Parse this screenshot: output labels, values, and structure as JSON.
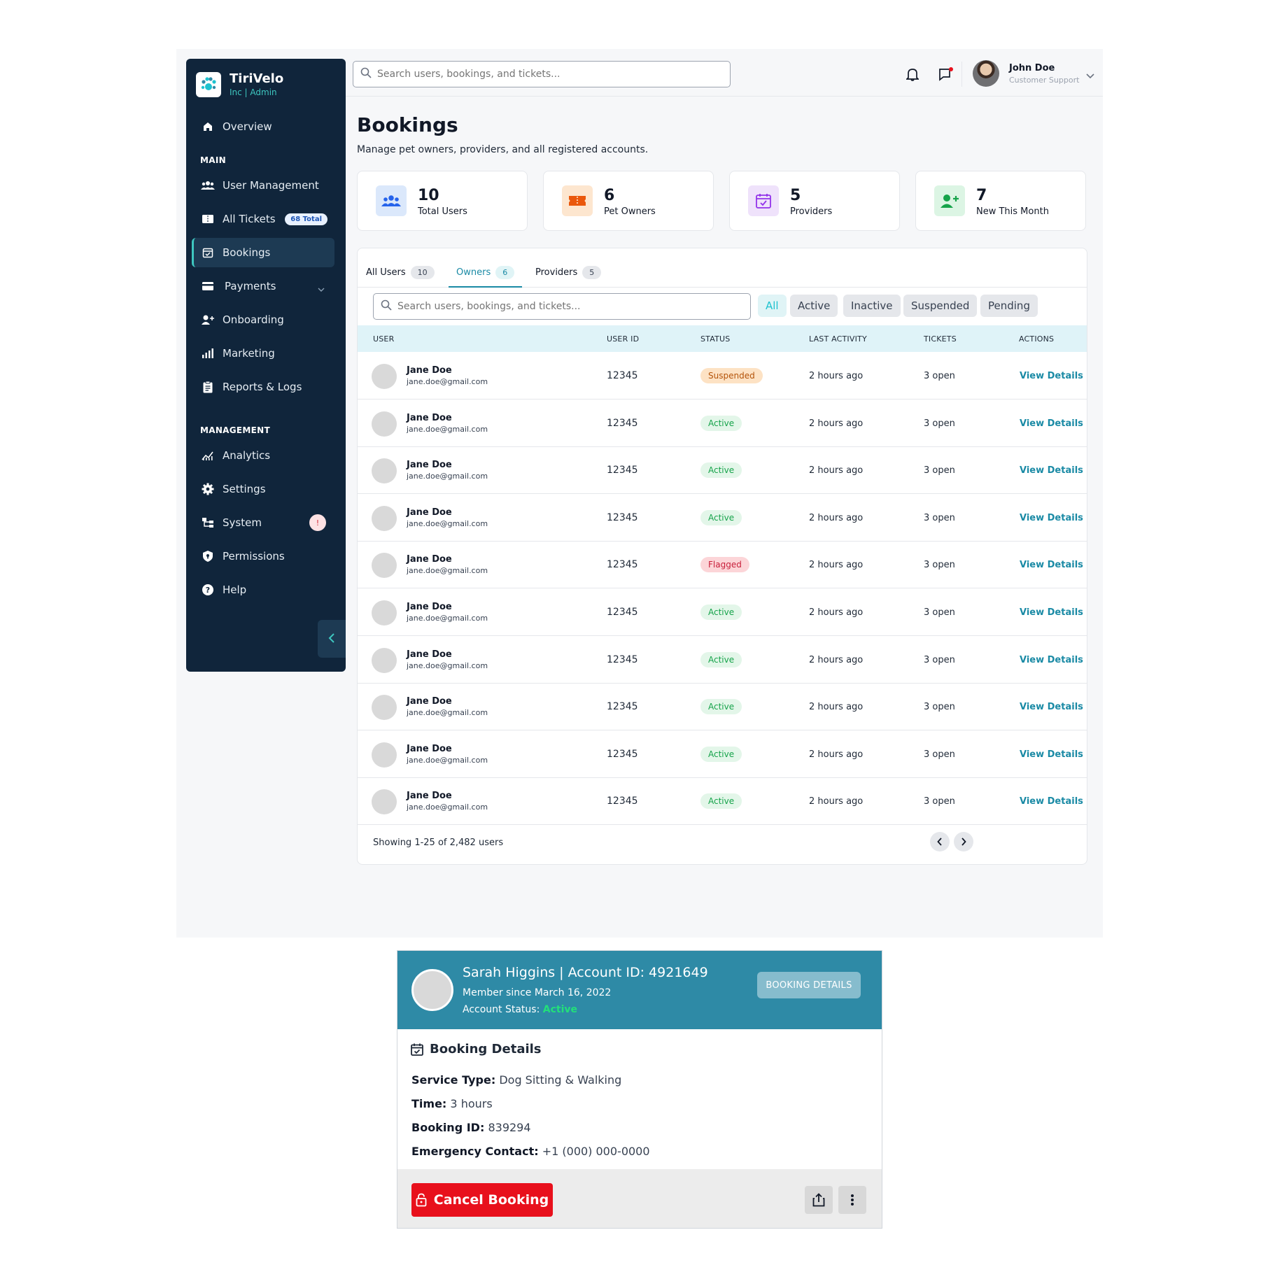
{
  "brand": {
    "name": "TiriVelo",
    "sub": "Inc | Admin"
  },
  "sidebar": {
    "overview": "Overview",
    "section_main": "MAIN",
    "section_management": "MANAGEMENT",
    "items": [
      {
        "label": "User Management",
        "icon": "users-icon"
      },
      {
        "label": "All Tickets",
        "icon": "ticket-icon",
        "badge": "68 Total"
      },
      {
        "label": "Bookings",
        "icon": "calendar-check-icon",
        "active": true
      },
      {
        "label": "Payments",
        "icon": "credit-card-icon"
      },
      {
        "label": "Onboarding",
        "icon": "user-plus-icon"
      },
      {
        "label": "Marketing",
        "icon": "bar-chart-icon"
      },
      {
        "label": "Reports & Logs",
        "icon": "clipboard-icon"
      }
    ],
    "management_items": [
      {
        "label": "Analytics",
        "icon": "line-chart-icon"
      },
      {
        "label": "Settings",
        "icon": "gear-icon"
      },
      {
        "label": "System",
        "icon": "network-icon",
        "badge": "!"
      },
      {
        "label": "Permissions",
        "icon": "shield-icon"
      },
      {
        "label": "Help",
        "icon": "help-circle-icon"
      }
    ]
  },
  "topbar": {
    "search_placeholder": "Search users, bookings, and tickets...",
    "user_name": "John Doe",
    "user_role": "Customer Support"
  },
  "page": {
    "title": "Bookings",
    "subtitle": "Manage pet owners, providers, and all registered accounts."
  },
  "stats": [
    {
      "value": "10",
      "label": "Total Users"
    },
    {
      "value": "6",
      "label": "Pet Owners"
    },
    {
      "value": "5",
      "label": "Providers"
    },
    {
      "value": "7",
      "label": "New This Month"
    }
  ],
  "tabs": [
    {
      "label": "All Users",
      "count": "10"
    },
    {
      "label": "Owners",
      "count": "6"
    },
    {
      "label": "Providers",
      "count": "5"
    }
  ],
  "filters": {
    "search_placeholder": "Search users, bookings, and tickets...",
    "chips": [
      "All",
      "Active",
      "Inactive",
      "Suspended",
      "Pending"
    ]
  },
  "table": {
    "headers": [
      "USER",
      "USER ID",
      "STATUS",
      "LAST ACTIVITY",
      "TICKETS",
      "ACTIONS"
    ],
    "rows": [
      {
        "name": "Jane Doe",
        "email": "jane.doe@gmail.com",
        "id": "12345",
        "status": "Suspended",
        "activity": "2 hours ago",
        "tickets": "3 open",
        "action": "View Details"
      },
      {
        "name": "Jane Doe",
        "email": "jane.doe@gmail.com",
        "id": "12345",
        "status": "Active",
        "activity": "2 hours ago",
        "tickets": "3 open",
        "action": "View Details"
      },
      {
        "name": "Jane Doe",
        "email": "jane.doe@gmail.com",
        "id": "12345",
        "status": "Active",
        "activity": "2 hours ago",
        "tickets": "3 open",
        "action": "View Details"
      },
      {
        "name": "Jane Doe",
        "email": "jane.doe@gmail.com",
        "id": "12345",
        "status": "Active",
        "activity": "2 hours ago",
        "tickets": "3 open",
        "action": "View Details"
      },
      {
        "name": "Jane Doe",
        "email": "jane.doe@gmail.com",
        "id": "12345",
        "status": "Flagged",
        "activity": "2 hours ago",
        "tickets": "3 open",
        "action": "View Details"
      },
      {
        "name": "Jane Doe",
        "email": "jane.doe@gmail.com",
        "id": "12345",
        "status": "Active",
        "activity": "2 hours ago",
        "tickets": "3 open",
        "action": "View Details"
      },
      {
        "name": "Jane Doe",
        "email": "jane.doe@gmail.com",
        "id": "12345",
        "status": "Active",
        "activity": "2 hours ago",
        "tickets": "3 open",
        "action": "View Details"
      },
      {
        "name": "Jane Doe",
        "email": "jane.doe@gmail.com",
        "id": "12345",
        "status": "Active",
        "activity": "2 hours ago",
        "tickets": "3 open",
        "action": "View Details"
      },
      {
        "name": "Jane Doe",
        "email": "jane.doe@gmail.com",
        "id": "12345",
        "status": "Active",
        "activity": "2 hours ago",
        "tickets": "3 open",
        "action": "View Details"
      },
      {
        "name": "Jane Doe",
        "email": "jane.doe@gmail.com",
        "id": "12345",
        "status": "Active",
        "activity": "2 hours ago",
        "tickets": "3 open",
        "action": "View Details"
      }
    ],
    "footer": "Showing 1-25 of 2,482 users"
  },
  "booking": {
    "title": "Sarah Higgins | Account ID: 4921649",
    "since": "Member since March 16, 2022",
    "status_label": "Account Status:",
    "status_value": "Active",
    "header_button": "BOOKING DETAILS",
    "section_title": "Booking Details",
    "fields": [
      {
        "label": "Service Type:",
        "value": "Dog Sitting & Walking"
      },
      {
        "label": "Time:",
        "value": "3 hours"
      },
      {
        "label": "Booking ID:",
        "value": "839294"
      },
      {
        "label": "Emergency Contact:",
        "value": "+1 (000) 000-0000"
      }
    ],
    "cancel_label": "Cancel Booking"
  },
  "colors": {
    "sidebar_bg": "#10253b",
    "accent": "#1a8aa5",
    "booking_header": "#2e8aa6",
    "cancel": "#e8101c"
  }
}
